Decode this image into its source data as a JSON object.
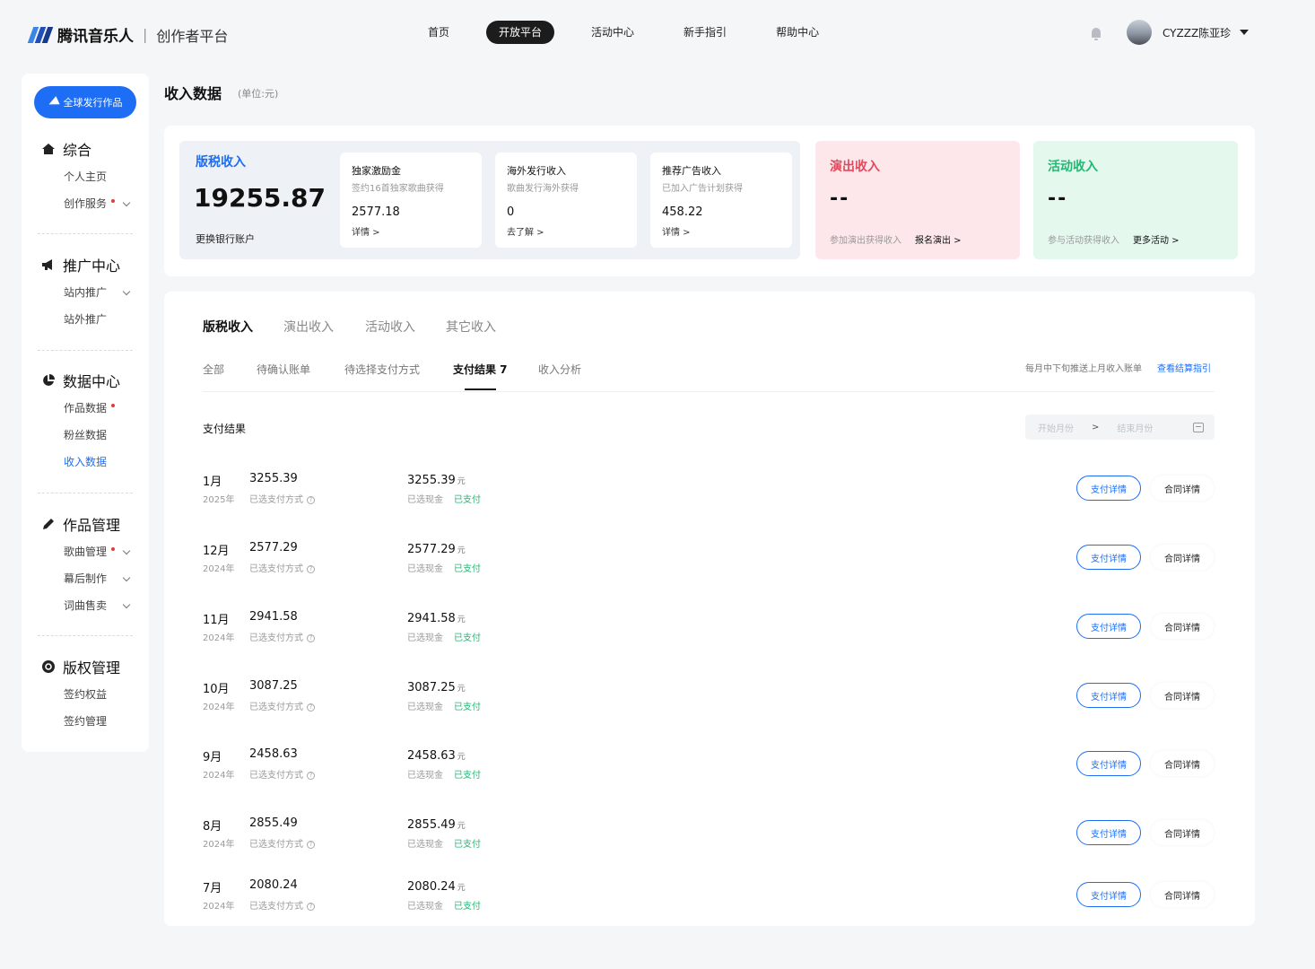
{
  "header": {
    "brand": "腾讯音乐人",
    "separator": "|",
    "subtitle": "创作者平台",
    "nav": [
      "首页",
      "开放平台",
      "活动中心",
      "新手指引",
      "帮助中心"
    ],
    "active_nav": "开放平台",
    "username": "CYZZZ陈亚珍"
  },
  "sidebar": {
    "publish_label": "全球发行作品",
    "groups": [
      {
        "title": "综合",
        "icon": "home-icon",
        "items": [
          {
            "label": "个人主页"
          },
          {
            "label": "创作服务",
            "dot": true,
            "expand": true
          }
        ]
      },
      {
        "title": "推广中心",
        "icon": "megaphone-icon",
        "items": [
          {
            "label": "站内推广",
            "expand": true
          },
          {
            "label": "站外推广"
          }
        ]
      },
      {
        "title": "数据中心",
        "icon": "pie-chart-icon",
        "items": [
          {
            "label": "作品数据",
            "dot": true
          },
          {
            "label": "粉丝数据"
          },
          {
            "label": "收入数据",
            "active": true
          }
        ]
      },
      {
        "title": "作品管理",
        "icon": "pencil-icon",
        "items": [
          {
            "label": "歌曲管理",
            "dot": true,
            "expand": true
          },
          {
            "label": "幕后制作",
            "expand": true
          },
          {
            "label": "词曲售卖",
            "expand": true
          }
        ]
      },
      {
        "title": "版权管理",
        "icon": "copyright-icon",
        "items": [
          {
            "label": "签约权益"
          },
          {
            "label": "签约管理"
          }
        ]
      }
    ]
  },
  "page": {
    "title": "收入数据",
    "unit": "(单位:元)"
  },
  "summary": {
    "royalty": {
      "title": "版税收入",
      "amount": "19255.87",
      "link": "更换银行账户"
    },
    "cards": [
      {
        "title": "独家激励金",
        "desc": "签约16首独家歌曲获得",
        "value": "2577.18",
        "link": "详情 >"
      },
      {
        "title": "海外发行收入",
        "desc": "歌曲发行海外获得",
        "value": "0",
        "link": "去了解 >"
      },
      {
        "title": "推荐广告收入",
        "desc": "已加入广告计划获得",
        "value": "458.22",
        "link": "详情 >"
      }
    ],
    "performance": {
      "title": "演出收入",
      "value": "--",
      "desc": "参加演出获得收入",
      "link": "报名演出 >"
    },
    "activity": {
      "title": "活动收入",
      "value": "--",
      "desc": "参与活动获得收入",
      "link": "更多活动 >"
    }
  },
  "tabs": [
    "版税收入",
    "演出收入",
    "活动收入",
    "其它收入"
  ],
  "active_tab": "版税收入",
  "subtabs": [
    "全部",
    "待确认账单",
    "待选择支付方式",
    "支付结果 7",
    "收入分析"
  ],
  "active_subtab": "支付结果 7",
  "notice": "每月中下旬推送上月收入账单",
  "notice_link": "查看结算指引",
  "section_label": "支付结果",
  "date_range": {
    "start_placeholder": "开始月份",
    "separator": ">",
    "end_placeholder": "结束月份"
  },
  "row_labels": {
    "payment_method": "已选支付方式",
    "cash": "已选现金",
    "paid": "已支付",
    "unit": "元",
    "pay_detail": "支付详情",
    "contract_detail": "合同详情"
  },
  "rows": [
    {
      "month": "1月",
      "year": "2025年",
      "amount": "3255.39"
    },
    {
      "month": "12月",
      "year": "2024年",
      "amount": "2577.29"
    },
    {
      "month": "11月",
      "year": "2024年",
      "amount": "2941.58"
    },
    {
      "month": "10月",
      "year": "2024年",
      "amount": "3087.25"
    },
    {
      "month": "9月",
      "year": "2024年",
      "amount": "2458.63"
    },
    {
      "month": "8月",
      "year": "2024年",
      "amount": "2855.49"
    },
    {
      "month": "7月",
      "year": "2024年",
      "amount": "2080.24"
    }
  ],
  "colors": {
    "accent": "#1e6ef5",
    "performance": "#e5485c",
    "activity": "#22b873"
  }
}
